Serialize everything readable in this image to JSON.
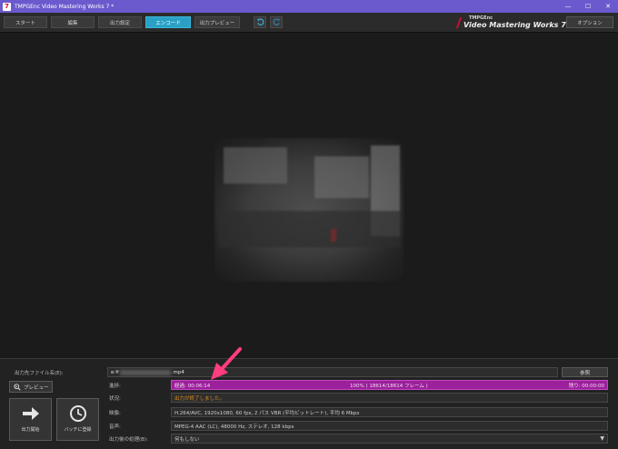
{
  "window": {
    "title": "TMPGEnc Video Mastering Works 7 *",
    "icon_letter": "7",
    "controls": {
      "minimize": "—",
      "maximize": "☐",
      "close": "✕"
    }
  },
  "toolbar": {
    "tabs": [
      {
        "label": "スタート",
        "active": false
      },
      {
        "label": "編集",
        "active": false
      },
      {
        "label": "出力設定",
        "active": false
      },
      {
        "label": "エンコード",
        "active": true
      },
      {
        "label": "出力プレビュー",
        "active": false
      }
    ],
    "undo_icon": "undo-icon",
    "redo_icon": "redo-icon",
    "brand_top": "TMPGEnc",
    "brand_name": "Video Mastering Works 7",
    "option_label": "オプション"
  },
  "panel": {
    "filename_label": "出力先ファイル名(E):",
    "filename_prefix": "e:¥",
    "filename_suffix": ".mp4",
    "browse_label": "参照",
    "preview_label": "プレビュー",
    "start_label": "出力開始",
    "batch_label": "バッチに登録",
    "progress_label": "進捗:",
    "progress": {
      "elapsed": "経過: 00:06:14",
      "center": "100% ( 18614/18614 フレーム )",
      "remaining": "残り: 00:00:00",
      "fraction": 1.0
    },
    "status_label": "状況:",
    "status_value": "出力が終了しました。",
    "video_label": "映像:",
    "video_value": "H.264/AVC, 1920x1080, 60 fps, 2 パス VBR (平均ビットレート), 平均 6 Mbps",
    "audio_label": "音声:",
    "audio_value": "MPEG-4 AAC (LC), 48000 Hz, ステレオ, 128 kbps",
    "after_label": "出力後の処理(B):",
    "after_value": "何もしない"
  },
  "colors": {
    "titlebar": "#6a5acd",
    "active_tab": "#2aa1c4",
    "progress": "#9c1f9c",
    "status": "#e08a1e",
    "annotation_arrow": "#ff3d7f"
  }
}
